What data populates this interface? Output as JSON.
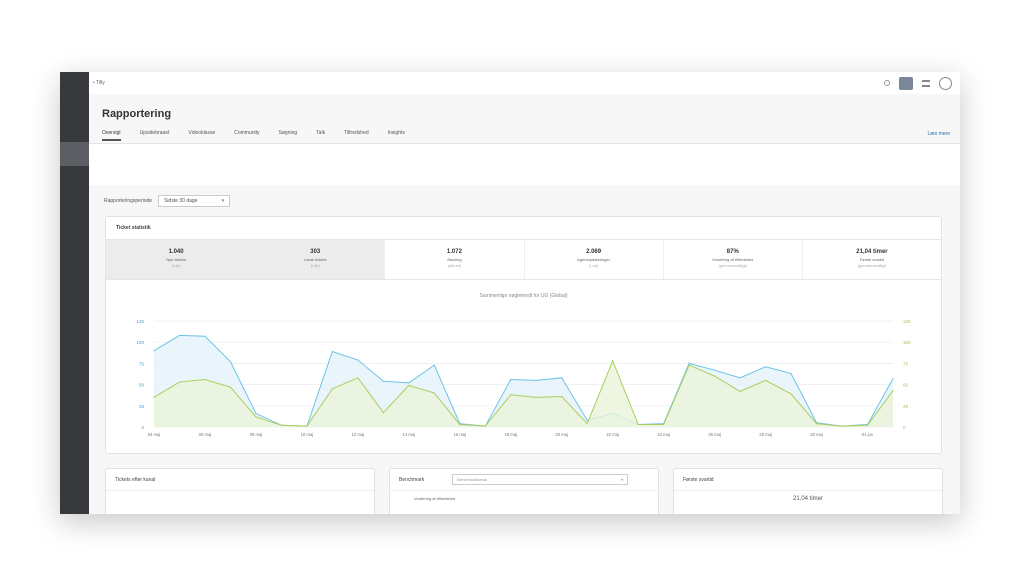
{
  "topbar": {
    "app_name": "• Tilly"
  },
  "header": {
    "title": "Rapportering",
    "tabs": [
      "Oversigt",
      "Upsidebraaet",
      "Videoklasse",
      "Community",
      "Søgning",
      "Talk",
      "Tilfredshed",
      "Insights"
    ],
    "learn_more": "Læs mere"
  },
  "period": {
    "label": "Rapporteringsperiode",
    "value": "Sidste 30 dage"
  },
  "tickets_card": {
    "title": "Ticket statistik",
    "stats": [
      {
        "value": "1.040",
        "label": "Nye tickets",
        "sub": "(i alt)"
      },
      {
        "value": "303",
        "label": "Løste tickets",
        "sub": "(i alt)"
      },
      {
        "value": "1.072",
        "label": "Backlog",
        "sub": "(aktuel)"
      },
      {
        "value": "2.069",
        "label": "Agentopdateringer",
        "sub": "(i alt)"
      },
      {
        "value": "87%",
        "label": "Vurdering af tilfredshed",
        "sub": "(gennemsnitligt)"
      },
      {
        "value": "21,04 timer",
        "label": "Første svartid",
        "sub": "(gennemsnitligt)"
      }
    ],
    "chart_title": "Sammenlign nøgletendt for UG (Global)"
  },
  "chart_data": {
    "type": "line",
    "categories": [
      "04 maj",
      "",
      "06 maj",
      "",
      "08 maj",
      "",
      "10 maj",
      "",
      "12 maj",
      "",
      "14 maj",
      "",
      "16 maj",
      "",
      "18 maj",
      "",
      "20 maj",
      "",
      "22 maj",
      "",
      "24 maj",
      "",
      "26 maj",
      "",
      "28 maj",
      "",
      "30 maj",
      "",
      "01 jun",
      ""
    ],
    "left_ticks": [
      "125",
      "100",
      "75",
      "50",
      "25",
      "0"
    ],
    "right_ticks": [
      "125",
      "100",
      "75",
      "50",
      "25",
      "0"
    ],
    "x_labels": [
      "04 maj",
      "06 maj",
      "08 maj",
      "10 maj",
      "12 maj",
      "14 maj",
      "16 maj",
      "18 maj",
      "20 maj",
      "22 maj",
      "24 maj",
      "26 maj",
      "28 maj",
      "30 maj",
      "01 jun"
    ],
    "ylim": [
      0,
      125
    ],
    "series": [
      {
        "color": "#6cc3e6",
        "fill": "#e3f3fa",
        "values": [
          90,
          108,
          107,
          77,
          16,
          2,
          1,
          89,
          79,
          54,
          52,
          73,
          4,
          1,
          56,
          55,
          58,
          8,
          16,
          3,
          4,
          75,
          67,
          58,
          71,
          63,
          5,
          1,
          3,
          57
        ]
      },
      {
        "color": "#a8cf5c",
        "fill": "#eaf4d9",
        "values": [
          35,
          53,
          56,
          47,
          12,
          2,
          1,
          45,
          58,
          17,
          49,
          40,
          3,
          1,
          38,
          35,
          36,
          4,
          78,
          3,
          3,
          73,
          60,
          42,
          55,
          39,
          4,
          1,
          2,
          43
        ]
      }
    ]
  },
  "bottom_cards": {
    "card1_title": "Tickets efter kanal",
    "card2_title": "Benchmark",
    "card2_select": "Benchmarkkanal",
    "card2_sub": "Vurdering af tilfredshed",
    "card3_title": "Første svartid",
    "card3_value": "21,04 timer"
  }
}
